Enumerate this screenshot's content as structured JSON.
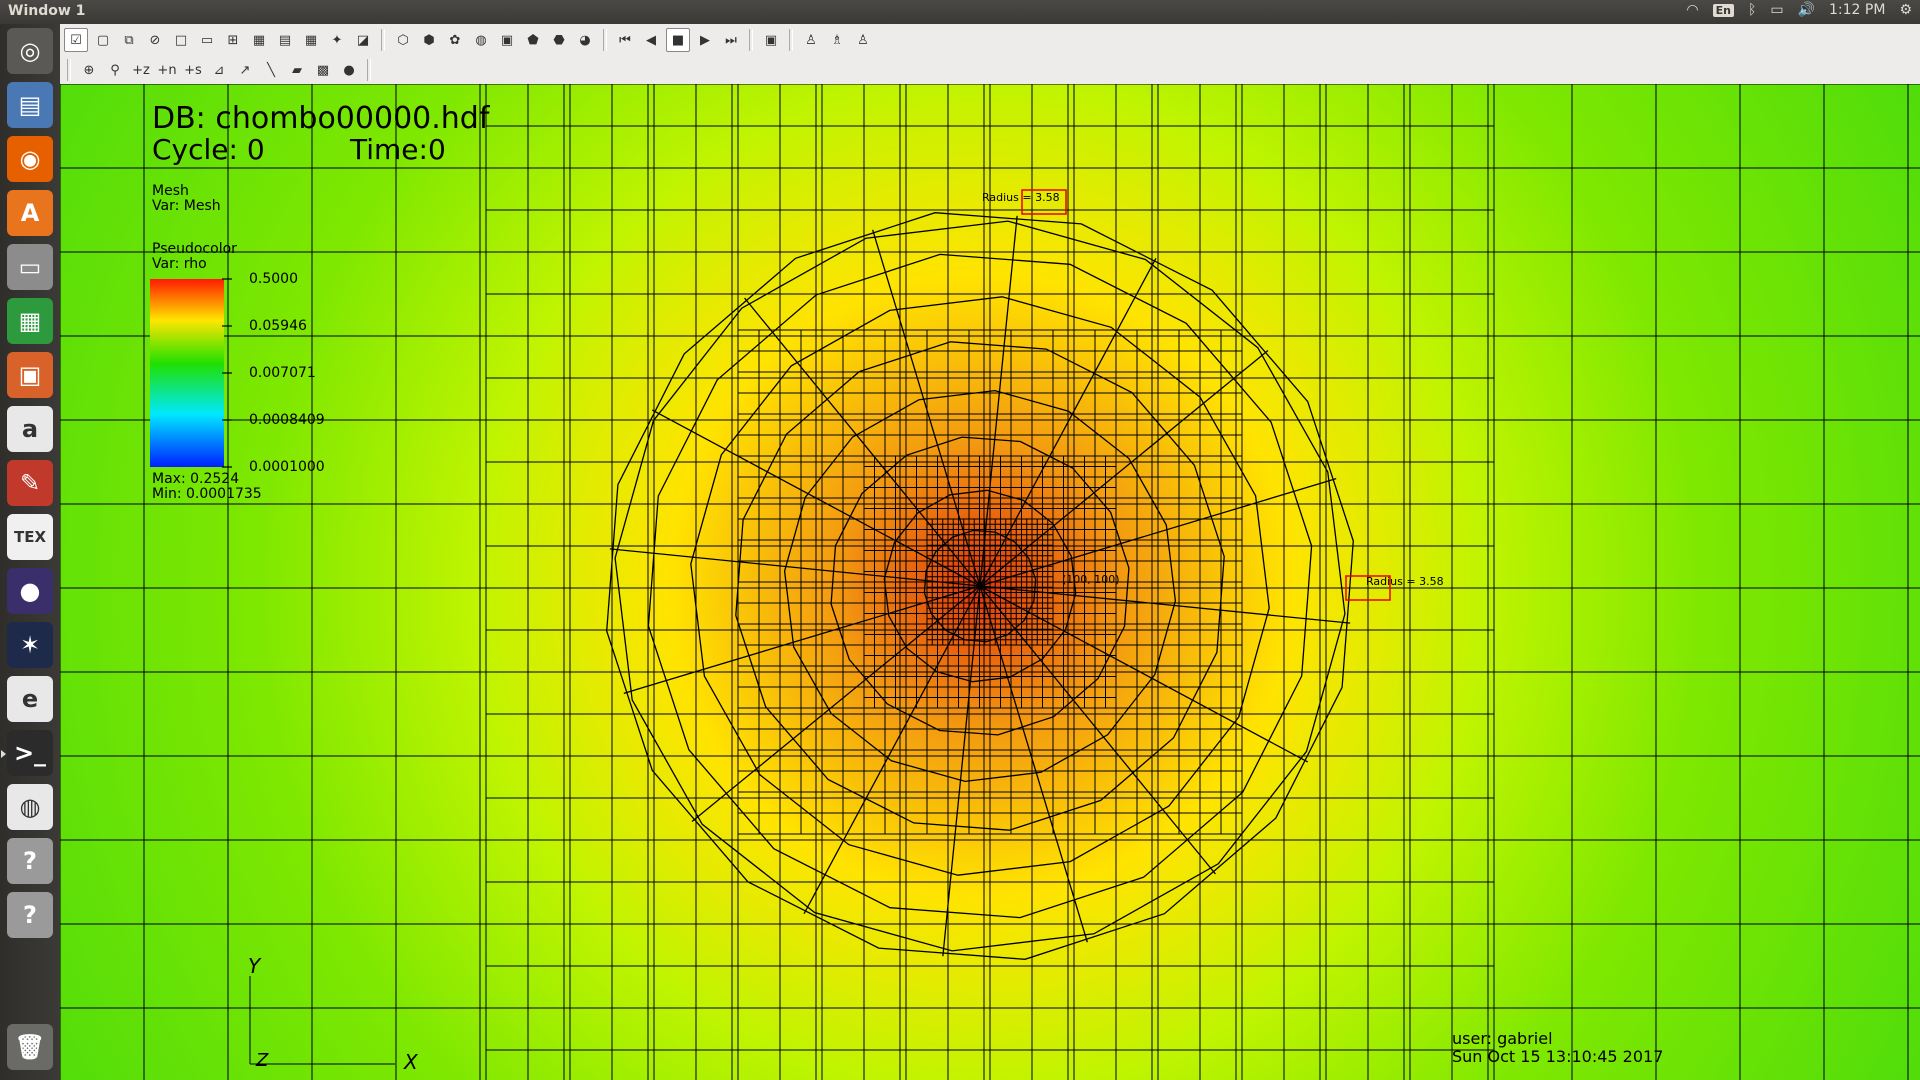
{
  "window": {
    "title": "Window 1"
  },
  "tray": {
    "lang": "En",
    "clock": "1:12 PM"
  },
  "launcher": [
    {
      "name": "ubuntu-dash-icon",
      "glyph": "◎",
      "bg": "#5a5955"
    },
    {
      "name": "files-icon",
      "glyph": "▤",
      "bg": "#4a78b5"
    },
    {
      "name": "firefox-icon",
      "glyph": "◉",
      "bg": "#e66000"
    },
    {
      "name": "software-center-icon",
      "glyph": "A",
      "bg": "#e8741e"
    },
    {
      "name": "drive-icon",
      "glyph": "▭",
      "bg": "#8c8c8c"
    },
    {
      "name": "calc-icon",
      "glyph": "▦",
      "bg": "#2e9a3e"
    },
    {
      "name": "impress-icon",
      "glyph": "▣",
      "bg": "#d9622b"
    },
    {
      "name": "amazon-icon",
      "glyph": "a",
      "bg": "#e8e8e8"
    },
    {
      "name": "settings-icon",
      "glyph": "✎",
      "bg": "#c0392b"
    },
    {
      "name": "texmaker-icon",
      "glyph": "TEX",
      "bg": "#f0f0f0"
    },
    {
      "name": "eclipse-icon",
      "glyph": "●",
      "bg": "#3a2f6b"
    },
    {
      "name": "visit-icon",
      "glyph": "✶",
      "bg": "#1e2a4a"
    },
    {
      "name": "evince-icon",
      "glyph": "e",
      "bg": "#e8e8e8"
    },
    {
      "name": "terminal-icon",
      "glyph": ">_",
      "bg": "#2b2b2b"
    },
    {
      "name": "chrome-icon",
      "glyph": "◍",
      "bg": "#e8e8e8"
    },
    {
      "name": "unknown-app-icon",
      "glyph": "?",
      "bg": "#9a9a9a"
    },
    {
      "name": "unknown-app-icon",
      "glyph": "?",
      "bg": "#9a9a9a"
    },
    {
      "name": "trash-icon",
      "glyph": "🗑",
      "bg": "#6a6a66"
    }
  ],
  "toolbar": {
    "row1": [
      "☑",
      "▢",
      "⧉",
      "⊘",
      "□",
      "▭",
      "⊞",
      "▦",
      "▤",
      "▦",
      "✦",
      "◪",
      "|",
      "⬡",
      "⬢",
      "✿",
      "◍",
      "▣",
      "⬟",
      "⬣",
      "◕",
      "|",
      "⏮",
      "◀",
      "■",
      "▶",
      "⏭",
      "|",
      "▣",
      "|",
      "♙",
      "♗",
      "♙"
    ],
    "row2": [
      "|",
      "⊕",
      "⚲",
      "+z",
      "+n",
      "+s",
      "⊿",
      "↗",
      "╲",
      "▰",
      "▩",
      "●",
      "|"
    ]
  },
  "plot": {
    "db": "DB: chombo00000.hdf",
    "cycle": "Cycle: 0",
    "time": "Time:0",
    "mesh_title": "Mesh",
    "mesh_var": "Var: Mesh",
    "pc_title": "Pseudocolor",
    "pc_var": "Var: rho",
    "ticks": [
      "0.5000",
      "0.05946",
      "0.007071",
      "0.0008409",
      "0.0001000"
    ],
    "max": "Max:  0.2524",
    "min": "Min:  0.0001735",
    "radius_top": "Radius = 3.58",
    "radius_right": "Radius = 3.58",
    "center_label": "(100, 100)",
    "axis_y": "Y",
    "axis_x": "X",
    "axis_z": "Z",
    "user": "user: gabriel",
    "date": "Sun Oct 15 13:10:45 2017"
  }
}
